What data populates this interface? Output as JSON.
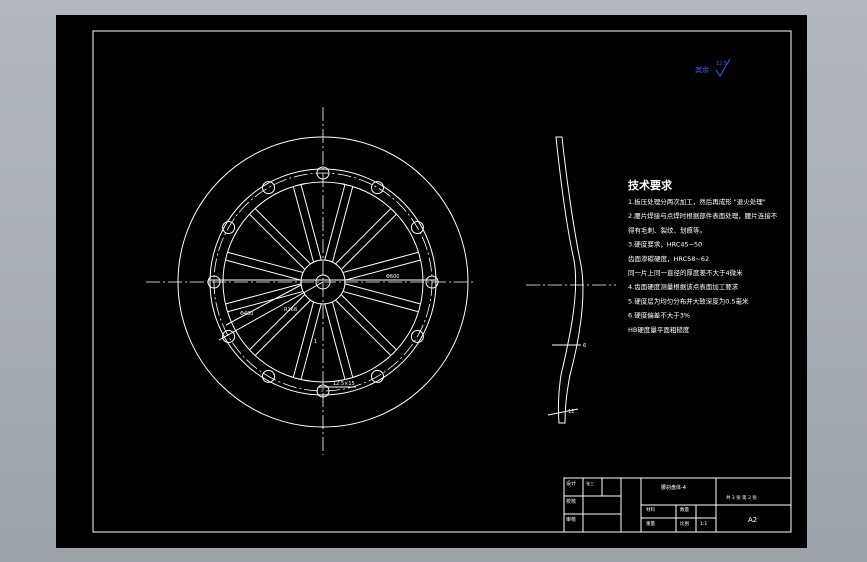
{
  "colors": {
    "line": "#ffffff",
    "accent": "#3060ff",
    "background": "#000000",
    "window": "#a8adb5"
  },
  "roughness_mark": {
    "label": "其余",
    "value": "12.5"
  },
  "front_view": {
    "dim_outer": "Φ600",
    "dim_inner": "Φ480",
    "dim_radial": "R168",
    "dim_left": "1",
    "dim_bottom": "12.5×15"
  },
  "side_view": {
    "dim_mid": "6",
    "dim_bottom": "12"
  },
  "tech_requirements": {
    "title": "技术要求",
    "items": [
      "1.板压处理分两次加工，然后再成形 \"退火处理\"",
      "2.腰片焊接与点焊时根据部件表面处理，腰片连接不",
      "得有毛刺、裂纹、划痕等。",
      "3.硬度要求，HRC45~50",
      "齿面渗碳硬度，HRC58~62",
      "同一片上同一直径的厚度差不大于4微米",
      "4.齿面硬度测量根据该点表面加工要求",
      "5.硬度层为均匀分布并大致深度为0.5毫米",
      "6.硬度偏差不大于3%",
      "HB硬度量平面粗糙度"
    ]
  },
  "title_block": {
    "row1_label": "设计",
    "row1_value": "张三",
    "row2_label": "校核",
    "row3_label": "审核",
    "part_name": "腰刹盘体-4",
    "material_label": "材料",
    "qty_label": "数量",
    "weight_label": "重量",
    "scale_label": "比例",
    "scale_value": "1:1",
    "sheet_info": "共 3 张 第 2 张",
    "drawing_code": "A2"
  }
}
